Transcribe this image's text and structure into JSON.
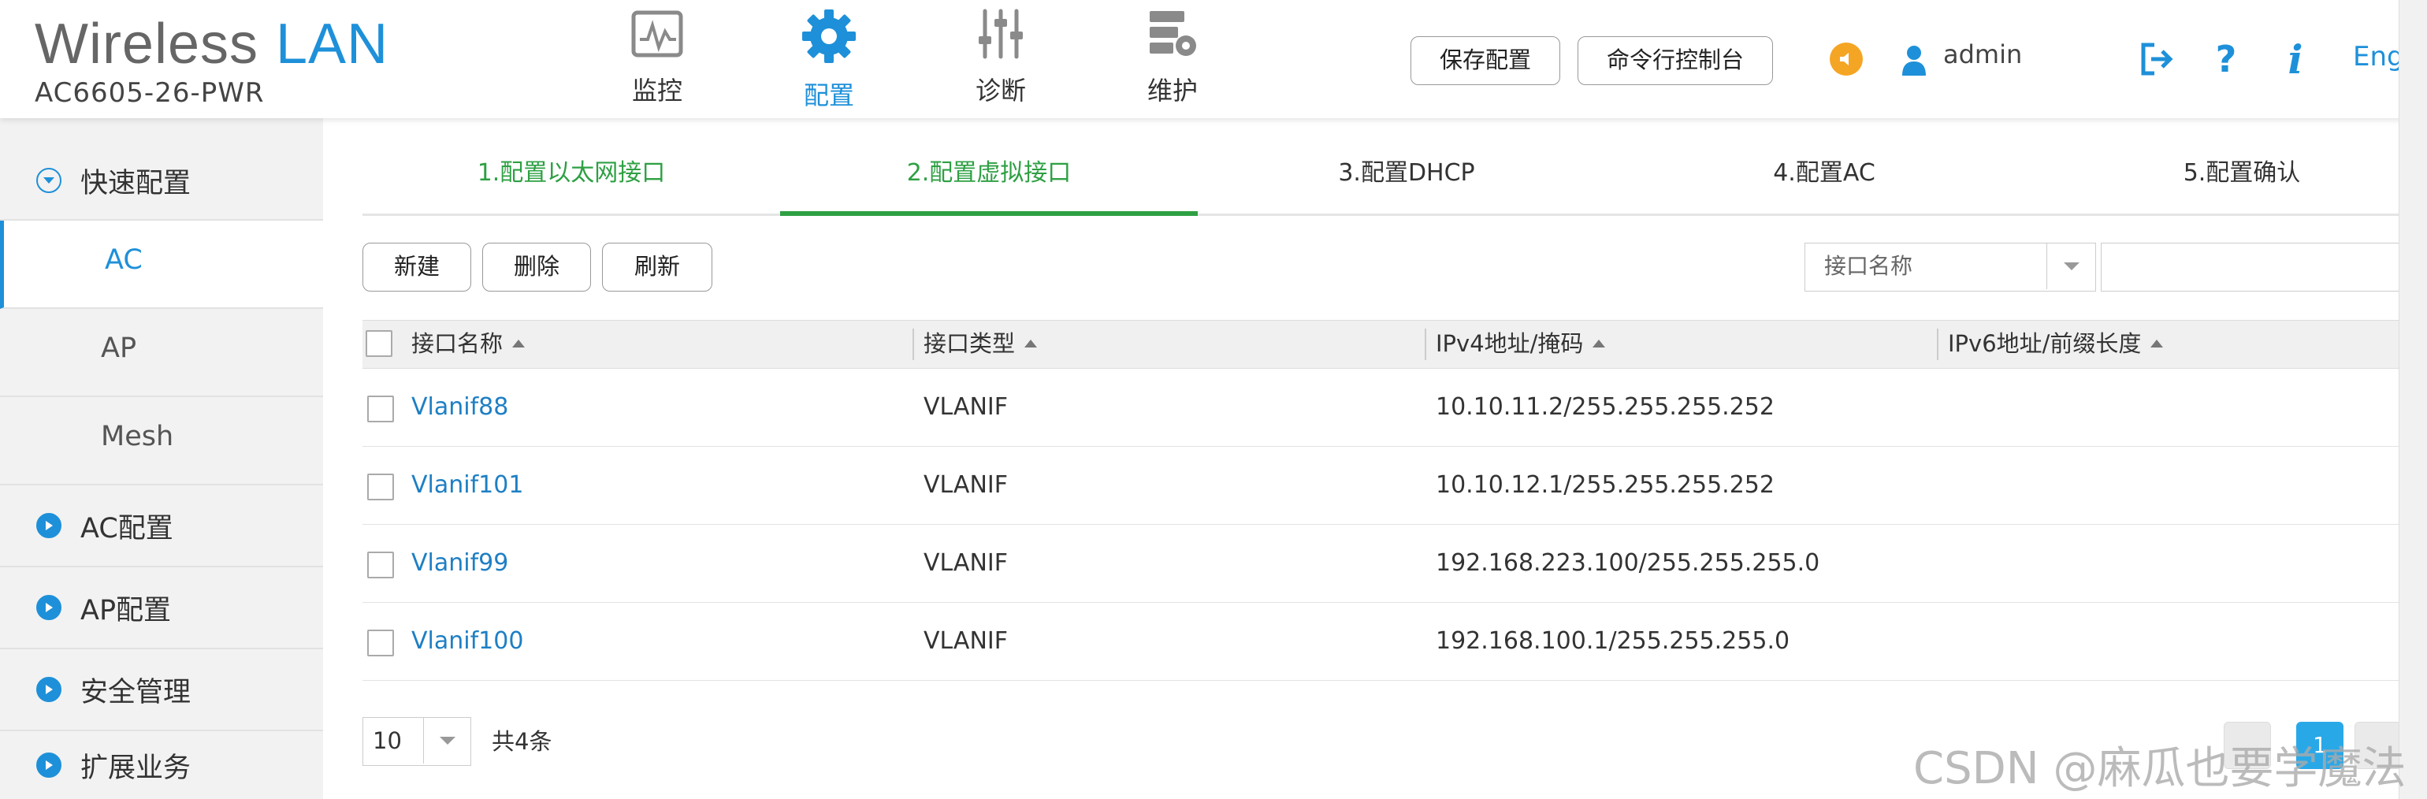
{
  "brand": {
    "title_part1": "Wireless",
    "title_part2": "LAN",
    "model": "AC6605-26-PWR"
  },
  "topnav": [
    {
      "label": "监控",
      "icon": "monitor-icon"
    },
    {
      "label": "配置",
      "icon": "gear-icon",
      "active": true
    },
    {
      "label": "诊断",
      "icon": "sliders-icon"
    },
    {
      "label": "维护",
      "icon": "maintenance-icon"
    }
  ],
  "header": {
    "save_label": "保存配置",
    "cli_label": "命令行控制台",
    "username": "admin",
    "help": "?",
    "info": "i",
    "language": "Eng"
  },
  "sidebar": {
    "items": [
      {
        "label": "快速配置",
        "type": "group",
        "expanded": true
      },
      {
        "label": "AC",
        "type": "sub",
        "active": true
      },
      {
        "label": "AP",
        "type": "sub"
      },
      {
        "label": "Mesh",
        "type": "sub"
      },
      {
        "label": "AC配置",
        "type": "group"
      },
      {
        "label": "AP配置",
        "type": "group"
      },
      {
        "label": "安全管理",
        "type": "group"
      },
      {
        "label": "扩展业务",
        "type": "group"
      }
    ]
  },
  "steps": [
    {
      "label": "1.配置以太网接口",
      "state": "done"
    },
    {
      "label": "2.配置虚拟接口",
      "state": "current"
    },
    {
      "label": "3.配置DHCP",
      "state": "pending"
    },
    {
      "label": "4.配置AC",
      "state": "pending"
    },
    {
      "label": "5.配置确认",
      "state": "pending"
    }
  ],
  "toolbar": {
    "new_label": "新建",
    "delete_label": "删除",
    "refresh_label": "刷新",
    "filter_selected": "接口名称",
    "search_value": ""
  },
  "table": {
    "columns": [
      "接口名称",
      "接口类型",
      "IPv4地址/掩码",
      "IPv6地址/前缀长度"
    ],
    "rows": [
      {
        "name": "Vlanif88",
        "type": "VLANIF",
        "ipv4": "10.10.11.2/255.255.255.252",
        "ipv6": ""
      },
      {
        "name": "Vlanif101",
        "type": "VLANIF",
        "ipv4": "10.10.12.1/255.255.255.252",
        "ipv6": ""
      },
      {
        "name": "Vlanif99",
        "type": "VLANIF",
        "ipv4": "192.168.223.100/255.255.255.0",
        "ipv6": ""
      },
      {
        "name": "Vlanif100",
        "type": "VLANIF",
        "ipv4": "192.168.100.1/255.255.255.0",
        "ipv6": ""
      }
    ]
  },
  "pager": {
    "page_size": "10",
    "total": "共4条",
    "current_page": "1"
  },
  "watermark": "CSDN @麻瓜也要学魔法",
  "colors": {
    "accent": "#1e90d9",
    "step_active": "#2ea043",
    "link": "#1e7fc4",
    "speaker": "#f5a524"
  }
}
